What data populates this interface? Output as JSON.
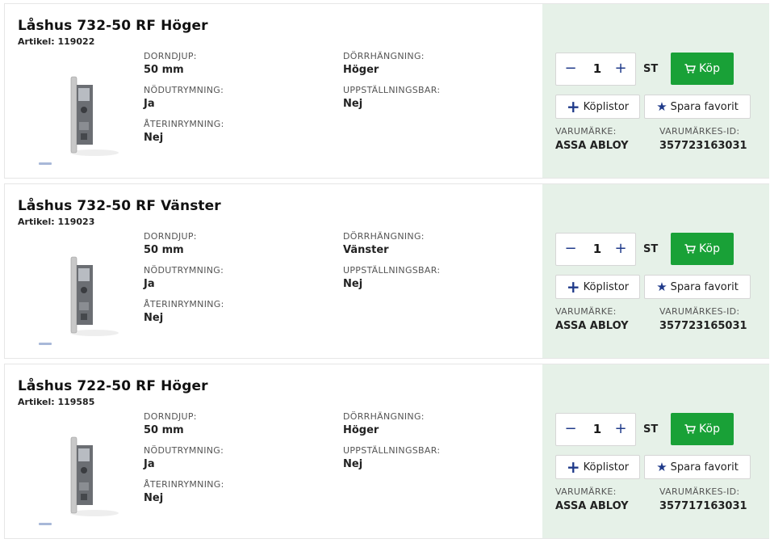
{
  "products": [
    {
      "title": "Låshus 732-50 RF Höger",
      "article": "Artikel: 119022",
      "specs": {
        "dorndjup_label": "DORNDJUP:",
        "dorndjup": "50 mm",
        "nodutrymning_label": "NÖDUTRYMNING:",
        "nodutrymning": "Ja",
        "aterinrymning_label": "ÅTERINRYMNING:",
        "aterinrymning": "Nej",
        "dorrhangning_label": "DÖRRHÄNGNING:",
        "dorrhangning": "Höger",
        "uppstallningsbar_label": "UPPSTÄLLNINGSBAR:",
        "uppstallningsbar": "Nej"
      },
      "quantity": "1",
      "unit": "ST",
      "buy_label": "Köp",
      "lists_label": "Köplistor",
      "favorite_label": "Spara favorit",
      "brand_label": "VARUMÄRKE:",
      "brand": "ASSA ABLOY",
      "brand_id_label": "VARUMÄRKES-ID:",
      "brand_id": "357723163031"
    },
    {
      "title": "Låshus 732-50 RF Vänster",
      "article": "Artikel: 119023",
      "specs": {
        "dorndjup_label": "DORNDJUP:",
        "dorndjup": "50 mm",
        "nodutrymning_label": "NÖDUTRYMNING:",
        "nodutrymning": "Ja",
        "aterinrymning_label": "ÅTERINRYMNING:",
        "aterinrymning": "Nej",
        "dorrhangning_label": "DÖRRHÄNGNING:",
        "dorrhangning": "Vänster",
        "uppstallningsbar_label": "UPPSTÄLLNINGSBAR:",
        "uppstallningsbar": "Nej"
      },
      "quantity": "1",
      "unit": "ST",
      "buy_label": "Köp",
      "lists_label": "Köplistor",
      "favorite_label": "Spara favorit",
      "brand_label": "VARUMÄRKE:",
      "brand": "ASSA ABLOY",
      "brand_id_label": "VARUMÄRKES-ID:",
      "brand_id": "357723165031"
    },
    {
      "title": "Låshus 722-50 RF Höger",
      "article": "Artikel: 119585",
      "specs": {
        "dorndjup_label": "DORNDJUP:",
        "dorndjup": "50 mm",
        "nodutrymning_label": "NÖDUTRYMNING:",
        "nodutrymning": "Ja",
        "aterinrymning_label": "ÅTERINRYMNING:",
        "aterinrymning": "Nej",
        "dorrhangning_label": "DÖRRHÄNGNING:",
        "dorrhangning": "Höger",
        "uppstallningsbar_label": "UPPSTÄLLNINGSBAR:",
        "uppstallningsbar": "Nej"
      },
      "quantity": "1",
      "unit": "ST",
      "buy_label": "Köp",
      "lists_label": "Köplistor",
      "favorite_label": "Spara favorit",
      "brand_label": "VARUMÄRKE:",
      "brand": "ASSA ABLOY",
      "brand_id_label": "VARUMÄRKES-ID:",
      "brand_id": "357717163031"
    }
  ],
  "icons": {
    "minus": "−",
    "plus": "+",
    "add": "+",
    "star": "★",
    "cart": "cart-icon"
  },
  "colors": {
    "buy_green": "#19a137",
    "panel_green": "#e6f1e8",
    "accent_blue": "#1f3a8a"
  }
}
